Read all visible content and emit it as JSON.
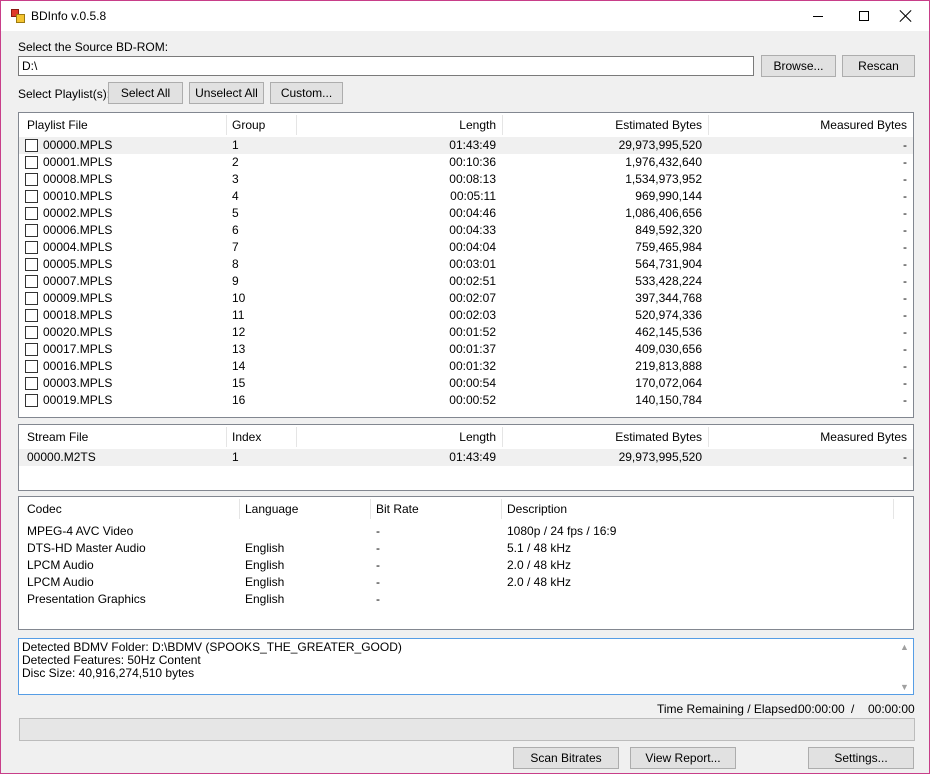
{
  "window": {
    "title": "BDInfo v.0.5.8"
  },
  "source": {
    "label": "Select the Source BD-ROM:",
    "path": "D:\\",
    "browse": "Browse...",
    "rescan": "Rescan"
  },
  "playlist_controls": {
    "label": "Select Playlist(s):",
    "select_all": "Select All",
    "unselect_all": "Unselect All",
    "custom": "Custom..."
  },
  "playlists": {
    "headers": [
      "Playlist File",
      "Group",
      "Length",
      "Estimated Bytes",
      "Measured Bytes"
    ],
    "rows": [
      {
        "file": "00000.MPLS",
        "group": "1",
        "length": "01:43:49",
        "est": "29,973,995,520",
        "measured": "-"
      },
      {
        "file": "00001.MPLS",
        "group": "2",
        "length": "00:10:36",
        "est": "1,976,432,640",
        "measured": "-"
      },
      {
        "file": "00008.MPLS",
        "group": "3",
        "length": "00:08:13",
        "est": "1,534,973,952",
        "measured": "-"
      },
      {
        "file": "00010.MPLS",
        "group": "4",
        "length": "00:05:11",
        "est": "969,990,144",
        "measured": "-"
      },
      {
        "file": "00002.MPLS",
        "group": "5",
        "length": "00:04:46",
        "est": "1,086,406,656",
        "measured": "-"
      },
      {
        "file": "00006.MPLS",
        "group": "6",
        "length": "00:04:33",
        "est": "849,592,320",
        "measured": "-"
      },
      {
        "file": "00004.MPLS",
        "group": "7",
        "length": "00:04:04",
        "est": "759,465,984",
        "measured": "-"
      },
      {
        "file": "00005.MPLS",
        "group": "8",
        "length": "00:03:01",
        "est": "564,731,904",
        "measured": "-"
      },
      {
        "file": "00007.MPLS",
        "group": "9",
        "length": "00:02:51",
        "est": "533,428,224",
        "measured": "-"
      },
      {
        "file": "00009.MPLS",
        "group": "10",
        "length": "00:02:07",
        "est": "397,344,768",
        "measured": "-"
      },
      {
        "file": "00018.MPLS",
        "group": "11",
        "length": "00:02:03",
        "est": "520,974,336",
        "measured": "-"
      },
      {
        "file": "00020.MPLS",
        "group": "12",
        "length": "00:01:52",
        "est": "462,145,536",
        "measured": "-"
      },
      {
        "file": "00017.MPLS",
        "group": "13",
        "length": "00:01:37",
        "est": "409,030,656",
        "measured": "-"
      },
      {
        "file": "00016.MPLS",
        "group": "14",
        "length": "00:01:32",
        "est": "219,813,888",
        "measured": "-"
      },
      {
        "file": "00003.MPLS",
        "group": "15",
        "length": "00:00:54",
        "est": "170,072,064",
        "measured": "-"
      },
      {
        "file": "00019.MPLS",
        "group": "16",
        "length": "00:00:52",
        "est": "140,150,784",
        "measured": "-"
      }
    ]
  },
  "streams": {
    "headers": [
      "Stream File",
      "Index",
      "Length",
      "Estimated Bytes",
      "Measured Bytes"
    ],
    "rows": [
      {
        "file": "00000.M2TS",
        "index": "1",
        "length": "01:43:49",
        "est": "29,973,995,520",
        "measured": "-"
      }
    ]
  },
  "codecs": {
    "headers": [
      "Codec",
      "Language",
      "Bit Rate",
      "Description"
    ],
    "rows": [
      {
        "codec": "MPEG-4 AVC Video",
        "language": "",
        "bitrate": "-",
        "desc": "1080p / 24 fps / 16:9"
      },
      {
        "codec": "DTS-HD Master Audio",
        "language": "English",
        "bitrate": "-",
        "desc": "5.1 / 48 kHz"
      },
      {
        "codec": "LPCM Audio",
        "language": "English",
        "bitrate": "-",
        "desc": "2.0 / 48 kHz"
      },
      {
        "codec": "LPCM Audio",
        "language": "English",
        "bitrate": "-",
        "desc": "2.0 / 48 kHz"
      },
      {
        "codec": "Presentation Graphics",
        "language": "English",
        "bitrate": "-",
        "desc": ""
      }
    ]
  },
  "info": {
    "lines": [
      "Detected BDMV Folder: D:\\BDMV (SPOOKS_THE_GREATER_GOOD)",
      "Detected Features: 50Hz Content",
      "Disc Size: 40,916,274,510 bytes"
    ]
  },
  "status": {
    "time_label": "Time Remaining / Elapsed:",
    "remaining": "00:00:00",
    "separator": "/",
    "elapsed": "00:00:00",
    "progress": 0
  },
  "buttons": {
    "scan": "Scan Bitrates",
    "report": "View Report...",
    "settings": "Settings..."
  }
}
